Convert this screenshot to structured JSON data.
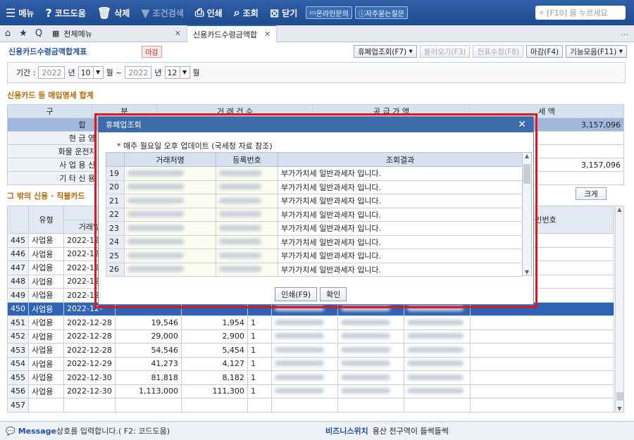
{
  "toolbar": {
    "menu": "메뉴",
    "help": "코드도움",
    "delete": "삭제",
    "cond_search": "조건검색",
    "print": "인쇄",
    "query": "조회",
    "close": "닫기",
    "online_inquiry": "온라인문의",
    "faq": "자주묻는질문",
    "search_placeholder": "[F10] 을 누르세요"
  },
  "tabs": [
    {
      "label": "전체메뉴"
    },
    {
      "label": "신용카드수령금액합"
    }
  ],
  "page": {
    "title": "신용카드수령금액합계표",
    "status_badge": "마감",
    "buttons": {
      "closure_query": "휴폐업조회(F7)",
      "load": "불러오기(F3)",
      "voucher_edit": "전표수정(F8)",
      "close_period": "마감(F4)",
      "functions": "기능모음(F11)"
    }
  },
  "period": {
    "label": "기간 :",
    "from_year": "2022",
    "from_month": "10",
    "to_year": "2022",
    "to_month": "12",
    "year_unit": "년",
    "month_unit": "월 ~",
    "month_unit_end": "월"
  },
  "summary": {
    "section_title": "신용카드 등 매입명세 합계",
    "headers": [
      "구",
      "분",
      "거 래 건 수",
      "공 급 가 액",
      "세 액"
    ],
    "rows": [
      {
        "label": "합",
        "amount": "3,157,096"
      },
      {
        "label": "현 금 영",
        "amount": ""
      },
      {
        "label": "화물 운전자 복",
        "amount": ""
      },
      {
        "label": "사 업 용 신 용",
        "amount": "3,157,096"
      },
      {
        "label": "기 타 신 용 카",
        "amount": ""
      }
    ],
    "expand_button": "크게"
  },
  "detail": {
    "section_title": "그 밖의 신용 · 직불카드",
    "headers": {
      "type": "유형",
      "date": "거래일",
      "approval": "승인번호"
    },
    "rows": [
      {
        "no": "445",
        "type": "사업용",
        "date": "2022-12-",
        "supply": "",
        "tax": "",
        "count": ""
      },
      {
        "no": "446",
        "type": "사업용",
        "date": "2022-12-",
        "supply": "",
        "tax": "",
        "count": ""
      },
      {
        "no": "447",
        "type": "사업용",
        "date": "2022-12-",
        "supply": "",
        "tax": "",
        "count": ""
      },
      {
        "no": "448",
        "type": "사업용",
        "date": "2022-12-",
        "supply": "",
        "tax": "",
        "count": ""
      },
      {
        "no": "449",
        "type": "사업용",
        "date": "2022-12-",
        "supply": "",
        "tax": "",
        "count": ""
      },
      {
        "no": "450",
        "type": "사업용",
        "date": "2022-12-",
        "supply": "",
        "tax": "",
        "count": "",
        "selected": true
      },
      {
        "no": "451",
        "type": "사업용",
        "date": "2022-12-28",
        "supply": "19,546",
        "tax": "1,954",
        "count": "1"
      },
      {
        "no": "452",
        "type": "사업용",
        "date": "2022-12-28",
        "supply": "29,000",
        "tax": "2,900",
        "count": "1"
      },
      {
        "no": "453",
        "type": "사업용",
        "date": "2022-12-28",
        "supply": "54,546",
        "tax": "5,454",
        "count": "1"
      },
      {
        "no": "454",
        "type": "사업용",
        "date": "2022-12-29",
        "supply": "41,273",
        "tax": "4,127",
        "count": "1"
      },
      {
        "no": "455",
        "type": "사업용",
        "date": "2022-12-30",
        "supply": "81,818",
        "tax": "8,182",
        "count": "1"
      },
      {
        "no": "456",
        "type": "사업용",
        "date": "2022-12-30",
        "supply": "1,113,000",
        "tax": "111,300",
        "count": "1"
      },
      {
        "no": "457",
        "type": "",
        "date": "",
        "supply": "",
        "tax": "",
        "count": ""
      }
    ]
  },
  "status": {
    "message_label": "Message",
    "message_text": "상호를 입력합니다.( F2: 코드도움)",
    "biz_label": "비즈니스위치",
    "biz_text": "용산 전구역이 들썩들썩"
  },
  "modal": {
    "title": "휴폐업조회",
    "note": "* 매주 월요일 오후 업데이트 (국세청 자료 참조)",
    "headers": [
      "거래처명",
      "등록번호",
      "조회결과"
    ],
    "rows": [
      {
        "no": "19",
        "result": "부가가치세 일반과세자 입니다."
      },
      {
        "no": "20",
        "result": "부가가치세 일반과세자 입니다."
      },
      {
        "no": "21",
        "result": "부가가치세 일반과세자 입니다."
      },
      {
        "no": "22",
        "result": "부가가치세 일반과세자 입니다."
      },
      {
        "no": "23",
        "result": "부가가치세 일반과세자 입니다."
      },
      {
        "no": "24",
        "result": "부가가치세 일반과세자 입니다."
      },
      {
        "no": "25",
        "result": "부가가치세 일반과세자 입니다."
      },
      {
        "no": "26",
        "result": "부가가치세 일반과세자 입니다."
      }
    ],
    "print_button": "인쇄(F9)",
    "confirm_button": "확인"
  }
}
